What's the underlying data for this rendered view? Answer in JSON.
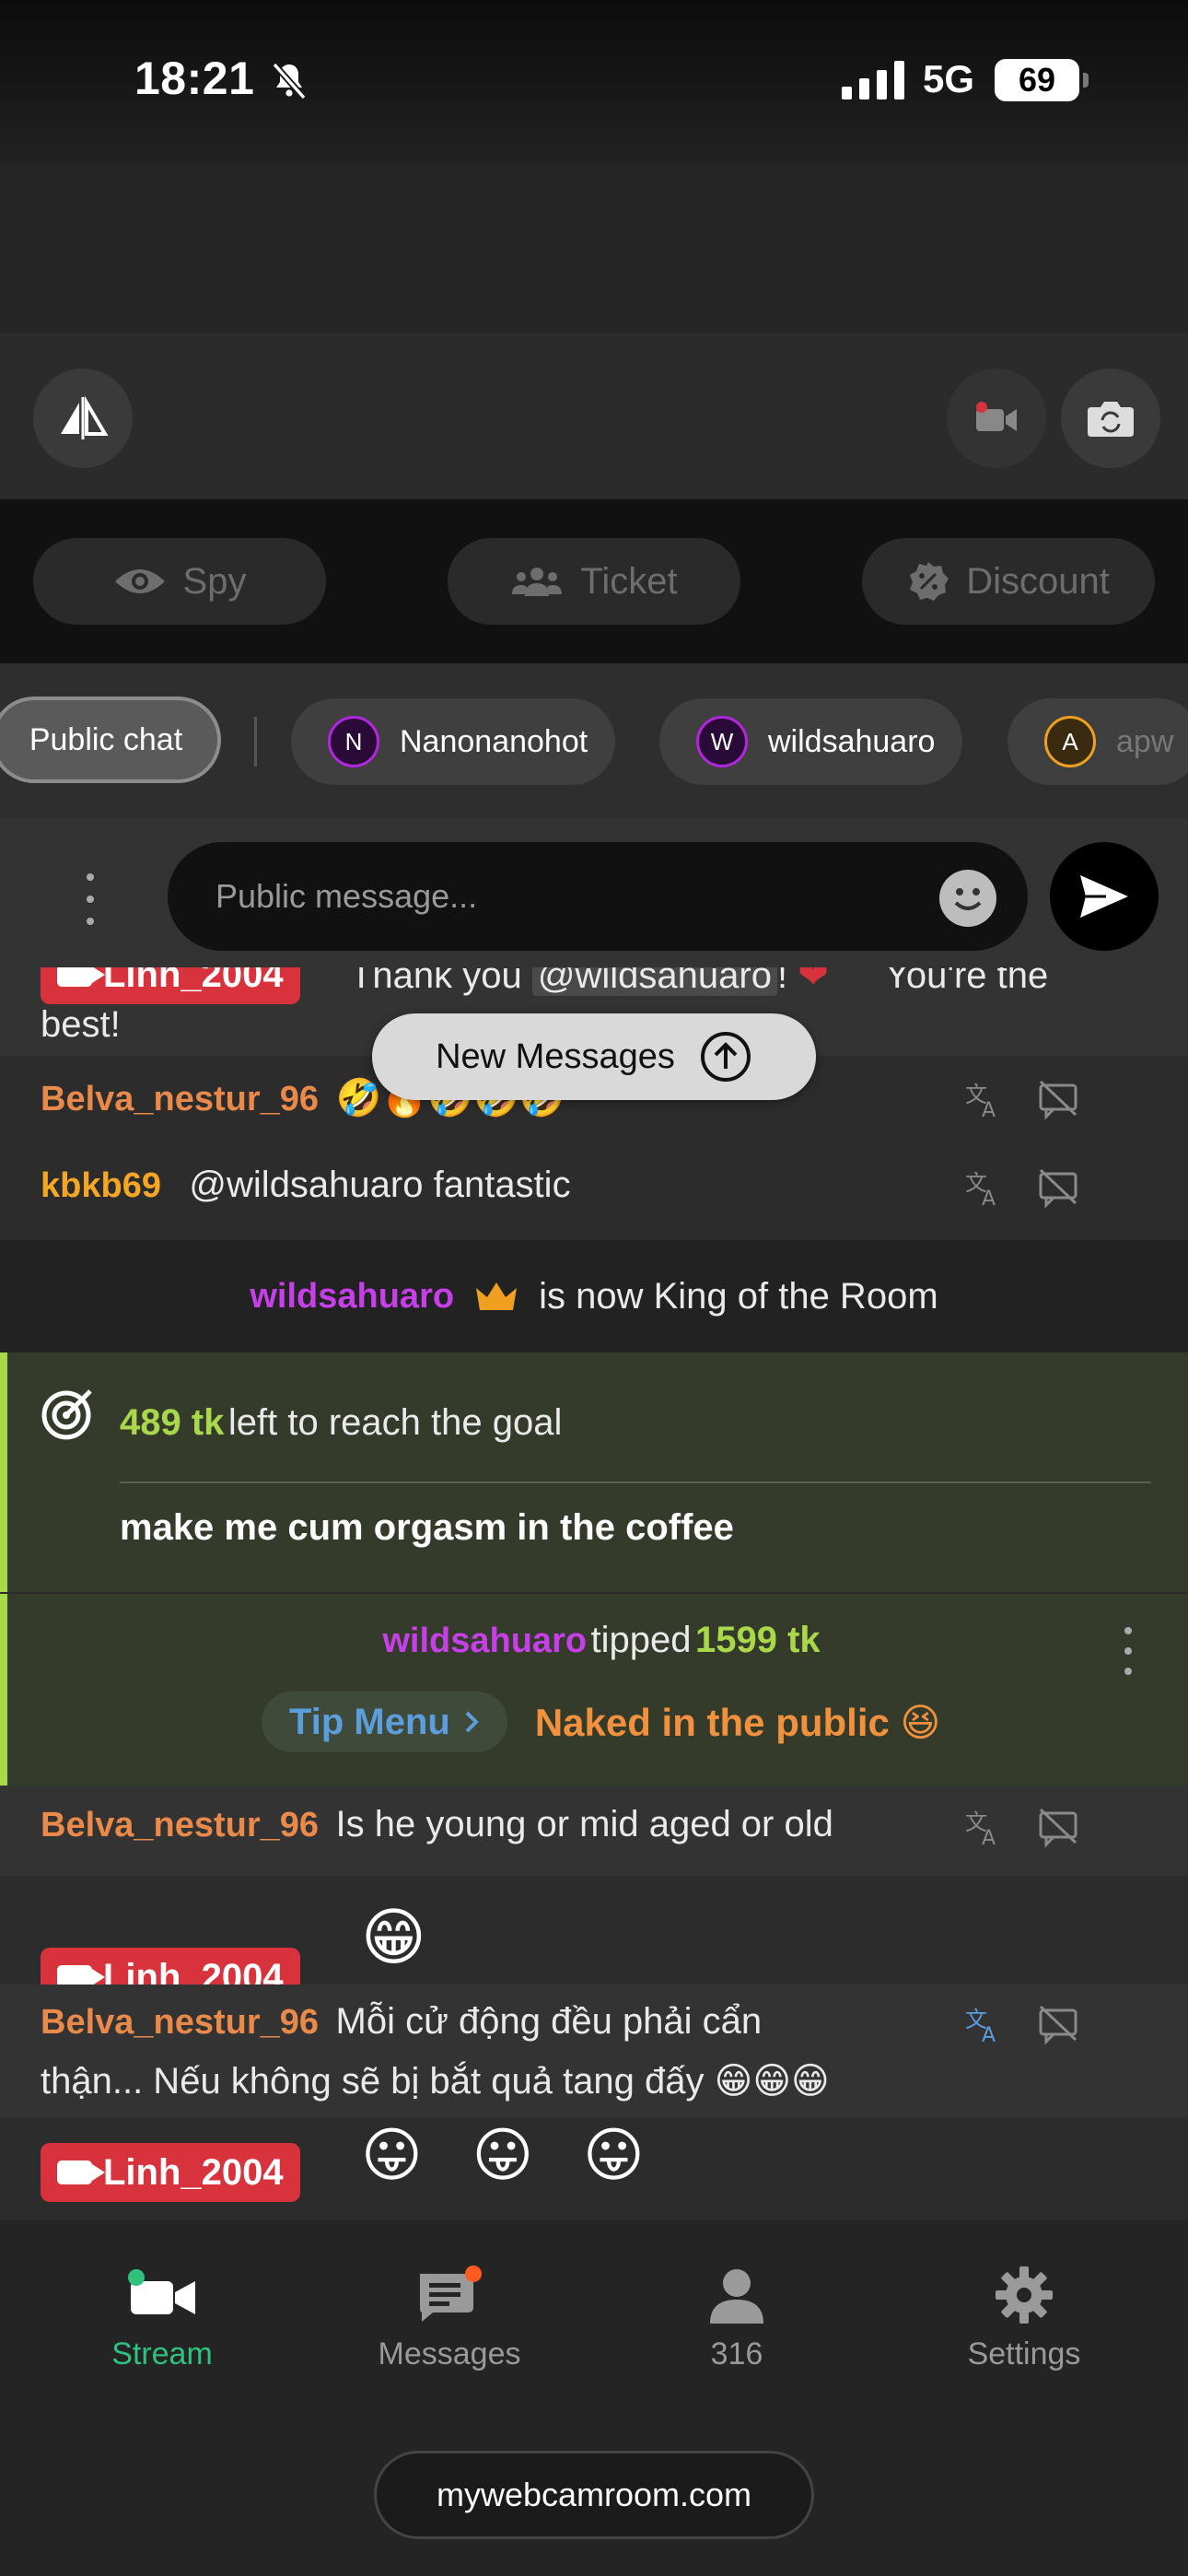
{
  "status_bar": {
    "time": "18:21",
    "network": "5G",
    "battery": "69"
  },
  "mode_buttons": {
    "spy": "Spy",
    "ticket": "Ticket",
    "discount": "Discount"
  },
  "tabs": {
    "public": "Public chat",
    "users": [
      {
        "initial": "N",
        "name": "Nanonanohot"
      },
      {
        "initial": "W",
        "name": "wildsahuaro"
      },
      {
        "initial": "A",
        "name": "apw"
      }
    ]
  },
  "composer": {
    "placeholder": "Public message..."
  },
  "new_messages_label": "New Messages",
  "chat": {
    "msg0": {
      "user": "Linh_2004",
      "text_pre": "Thank you",
      "mention": "@wildsahuaro",
      "text_post": "! ",
      "text_end": "You're the",
      "text_line2": "best!"
    },
    "msg1": {
      "user": "Belva_nestur_96",
      "text": "🤣🔥🤣🤣🤣"
    },
    "msg2": {
      "user": "kbkb69",
      "text": "@wildsahuaro  fantastic"
    },
    "king": {
      "user": "wildsahuaro",
      "text": "is now King of the Room"
    },
    "goal": {
      "amount": "489 tk",
      "text": "left to reach the goal",
      "title": "make me cum orgasm in the coffee"
    },
    "tip": {
      "user": "wildsahuaro",
      "verb": "tipped",
      "amount": "1599 tk",
      "menu_label": "Tip Menu",
      "item": "Naked in the public 😆"
    },
    "msg3": {
      "user": "Belva_nestur_96",
      "text": "Is he young or mid aged or old"
    },
    "msg4": {
      "user": "Linh_2004",
      "text": "😁"
    },
    "msg5": {
      "user": "Belva_nestur_96",
      "text_line1": "Mỗi cử động đều phải cẩn",
      "text_line2": "thận... Nếu không sẽ bị bắt quả tang đấy 😁😁😁"
    },
    "msg6": {
      "user": "Linh_2004",
      "text": "😛 😛 😛"
    }
  },
  "bottom_nav": {
    "stream": "Stream",
    "messages": "Messages",
    "viewers": "316",
    "settings": "Settings"
  },
  "url": "mywebcamroom.com",
  "colors": {
    "accent_green": "#2ec27e",
    "tip_green": "#a9d94a",
    "cam_red": "#d8323c",
    "purple_user": "#c63fe8",
    "orange_user": "#e98a4a"
  }
}
